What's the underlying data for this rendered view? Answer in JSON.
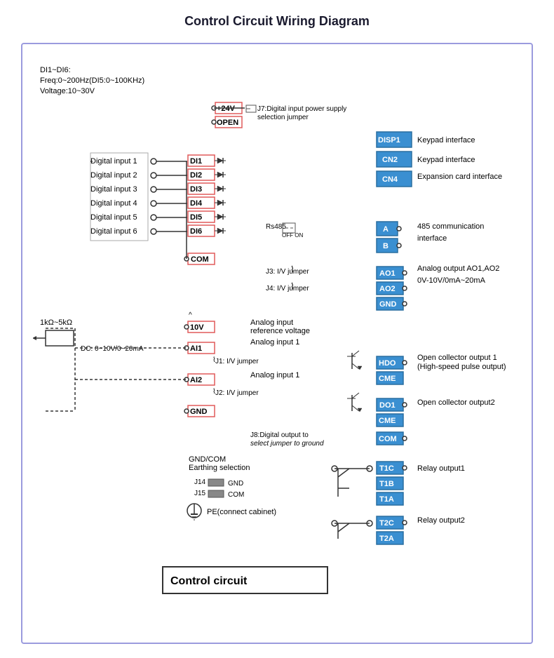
{
  "title": "Control Circuit Wiring Diagram",
  "subtitle": "Control circuit",
  "left_info": {
    "line1": "DI1~DI6:",
    "line2": "Freq:0~200Hz(DI5:0~100KHz)",
    "line3": "Voltage:10~30V"
  },
  "digital_inputs": [
    "Digital input 1",
    "Digital input 2",
    "Digital input 3",
    "Digital input 4",
    "Digital input 5",
    "Digital input 6"
  ],
  "di_terminals": [
    "DI1",
    "DI2",
    "DI3",
    "DI4",
    "DI5",
    "DI6"
  ],
  "terminals_left": [
    "+24V",
    "OPEN",
    "COM"
  ],
  "analog_section": {
    "range": "1kΩ~5kΩ",
    "dc_label": "DC: 0~10V/0~20mA",
    "terminals": [
      "10V",
      "AI1",
      "AI2",
      "GND"
    ],
    "j1": "J1: I/V jumper",
    "j2": "J2: I/V jumper"
  },
  "right_connectors": {
    "disp1": "DISP1",
    "cn2": "CN2",
    "cn4": "CN4",
    "a": "A",
    "b": "B",
    "ao1": "AO1",
    "ao2": "AO2",
    "gnd1": "GND",
    "hdo": "HDO",
    "cme1": "CME",
    "do1": "DO1",
    "cme2": "CME",
    "com": "COM",
    "t1c": "T1C",
    "t1b": "T1B",
    "t1a": "T1A",
    "t2c": "T2C",
    "t2a": "T2A"
  },
  "right_labels": {
    "disp1": "Keypad interface",
    "cn2": "Keypad interface",
    "cn4": "Expansion card interface",
    "ab": "485 communication\ninterface",
    "ao": "Analog output AO1,AO2\n0V-10V/0mA~20mA",
    "hdo": "Open collector output 1\n(High-speed pulse output)",
    "do1": "Open collector output2",
    "t1": "Relay output1",
    "t2": "Relay output2"
  },
  "jumpers": {
    "j3": "J3: I/V jumper",
    "j4": "J4: I/V jumper",
    "j7": "J7:Digital input power supply\nselection jumper",
    "j8": "J8:Digital output to\nselect jumper to ground",
    "rs485": "Rs485",
    "gnd_com": "GND/COM\nEarthing selection",
    "j14": "J14",
    "j15": "J15",
    "gnd_label": "GND",
    "com_label": "COM",
    "pe_label": "PE(connect cabinet)"
  },
  "colors": {
    "blue_terminal": "#3a8fd1",
    "red_border": "#e05a5a",
    "purple_border": "#9b9bde",
    "dark": "#1a1a2e"
  }
}
